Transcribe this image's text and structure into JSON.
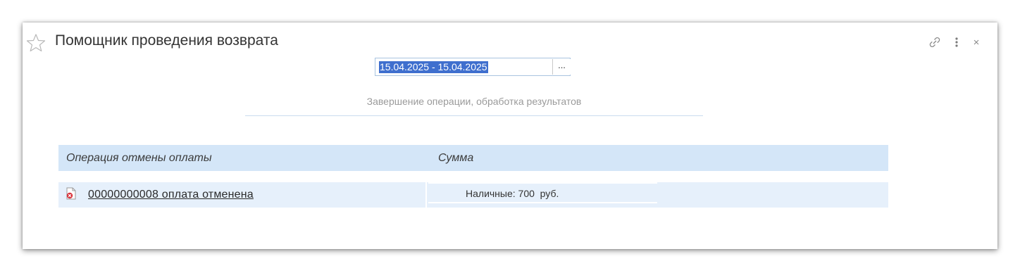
{
  "window": {
    "title": "Помощник проведения возврата",
    "icons": {
      "favorite": "star-outline-icon",
      "link": "link-icon",
      "more": "more-vertical-icon",
      "close": "close-icon"
    },
    "close_glyph": "×"
  },
  "period": {
    "value": "15.04.2025 - 15.04.2025",
    "select_button_label": "..."
  },
  "step": {
    "label": "Завершение операции, обработка результатов"
  },
  "table": {
    "columns": [
      "Операция отмены оплаты",
      "Сумма"
    ],
    "rows": [
      {
        "operation": "00000000008 оплата отменена",
        "sum": "Наличные: 700  руб.",
        "icon": "document-cancelled-icon"
      }
    ]
  },
  "colors": {
    "header_bg": "#d4e6f8",
    "row_bg": "#e6f0fb",
    "selection": "#3f6fce",
    "field_border": "#a9c4e0"
  }
}
